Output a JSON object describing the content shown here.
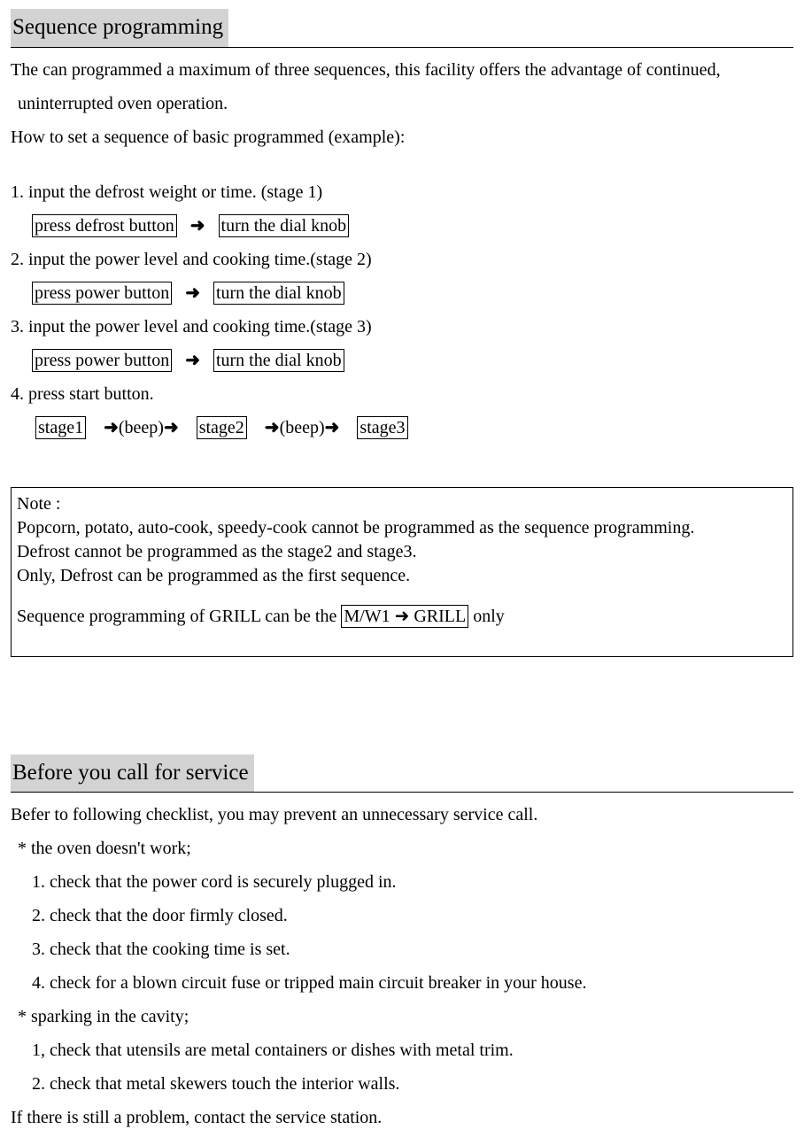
{
  "section1": {
    "title": "Sequence programming",
    "intro1": "The can programmed a maximum of three sequences, this facility offers the advantage of continued,",
    "intro2": "uninterrupted oven operation.",
    "howto": "How to set a sequence of basic programmed (example):",
    "step1": "1. input the defrost weight or time. (stage 1)",
    "step1a": "press defrost button",
    "step1b": "turn the dial knob",
    "step2": "2. input the power level and cooking time.(stage 2)",
    "step2a": "press power button",
    "step2b": "turn the dial knob",
    "step3": "3. input the power level and cooking time.(stage 3)",
    "step3a": "press power button",
    "step3b": "turn the dial knob",
    "step4": "4. press start button.",
    "stage1": "stage1",
    "stage2": "stage2",
    "stage3": "stage3",
    "beep": "(beep)",
    "arrow": "➜"
  },
  "note": {
    "title": "Note :",
    "line1": "Popcorn, potato, auto-cook, speedy-cook cannot be programmed as the sequence programming.",
    "line2": "Defrost cannot be programmed as the stage2 and stage3.",
    "line3": "Only, Defrost can be programmed as the first sequence.",
    "line4a": "Sequence programming of GRILL can be the ",
    "line4box": "M/W1 ➜ GRILL",
    "line4b": " only"
  },
  "section2": {
    "title": "Before you call for service",
    "intro": "Befer to following checklist, you may prevent an unnecessary service call.",
    "h1": "* the oven doesn't work;",
    "c1": "1. check that the power cord is securely plugged in.",
    "c2": "2. check that the door firmly closed.",
    "c3": "3. check that the cooking time is set.",
    "c4": "4. check for a blown circuit fuse or tripped main circuit breaker in your house.",
    "h2": "* sparking in the cavity;",
    "c5": "1, check that utensils are metal containers or dishes with metal trim.",
    "c6": "2. check that metal skewers touch the interior walls.",
    "outro": "If there is still a problem, contact the service station."
  }
}
